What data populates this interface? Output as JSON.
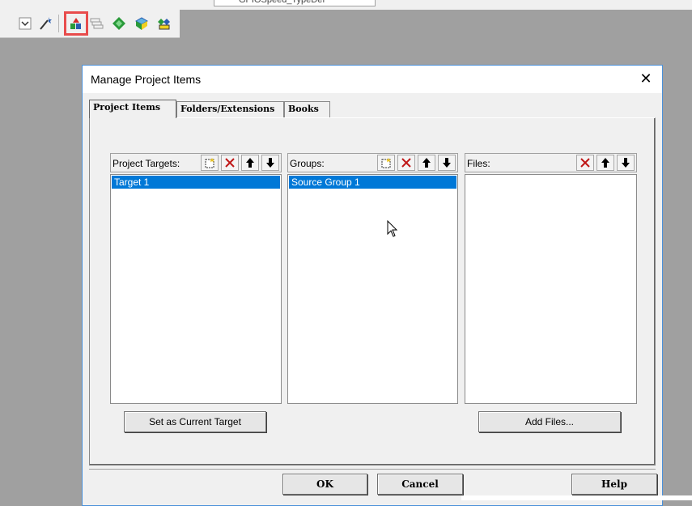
{
  "toolbar_top": {
    "config_combo": "GPIOSpeed_TypeDef"
  },
  "toolbar": {
    "icons": [
      "dropdown-checkbox-icon",
      "magic-wand-icon",
      "manage-project-items-icon",
      "layers-icon",
      "green-diamond-icon",
      "blue-diamond-icon",
      "multi-diamond-icon"
    ]
  },
  "dialog": {
    "title": "Manage Project Items",
    "close": "✕",
    "tabs": [
      "Project Items",
      "Folders/Extensions",
      "Books"
    ],
    "targets": {
      "label": "Project Targets:",
      "items": [
        "Target 1"
      ],
      "action": "Set as Current Target"
    },
    "groups": {
      "label": "Groups:",
      "items": [
        "Source Group 1"
      ]
    },
    "files": {
      "label": "Files:",
      "items": [],
      "action": "Add Files..."
    },
    "buttons": {
      "ok": "OK",
      "cancel": "Cancel",
      "help": "Help"
    }
  },
  "colors": {
    "selection": "#0078d7",
    "highlight": "#e84c4c",
    "dialog_border": "#4a90d9"
  }
}
